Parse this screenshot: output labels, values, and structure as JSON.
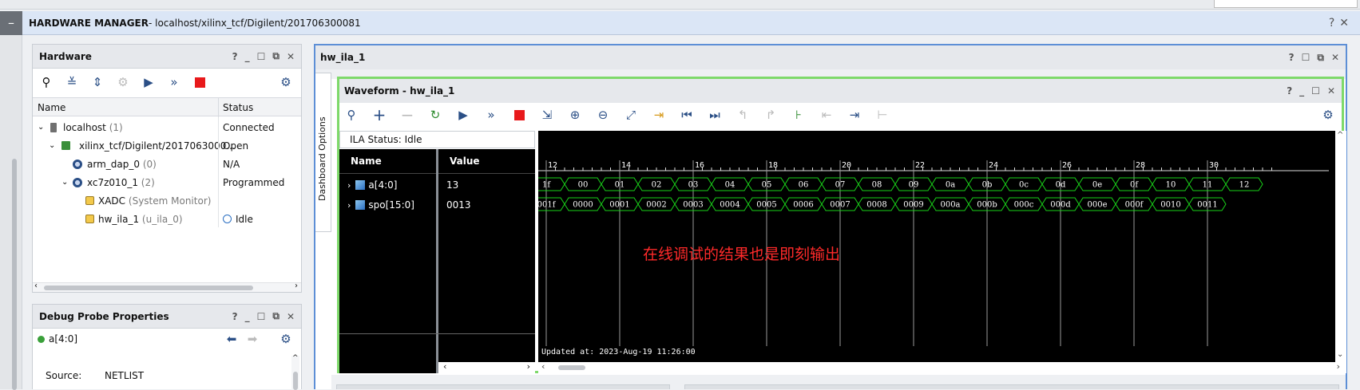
{
  "top_bar": {
    "title": "HARDWARE MANAGER",
    "subtitle": " - localhost/xilinx_tcf/Digilent/201706300081"
  },
  "hardware_panel": {
    "title": "Hardware",
    "col_name": "Name",
    "col_status": "Status",
    "rows": [
      {
        "label": "localhost",
        "extra": "(1)",
        "status": "Connected"
      },
      {
        "label": "xilinx_tcf/Digilent/2017063000...",
        "extra": "",
        "status": "Open"
      },
      {
        "label": "arm_dap_0",
        "extra": "(0)",
        "status": "N/A"
      },
      {
        "label": "xc7z010_1",
        "extra": "(2)",
        "status": "Programmed"
      },
      {
        "label": "XADC",
        "extra": "(System Monitor)",
        "status": ""
      },
      {
        "label": "hw_ila_1",
        "extra": "(u_ila_0)",
        "status": "Idle"
      }
    ]
  },
  "debug_panel": {
    "title": "Debug Probe Properties",
    "probe": "a[4:0]",
    "source_label": "Source:",
    "source_value": "NETLIST"
  },
  "ila_panel": {
    "tab": "hw_ila_1",
    "dashboard_label": "Dashboard Options",
    "waveform_title": "Waveform - hw_ila_1",
    "ila_status": "ILA Status:  Idle",
    "col_name": "Name",
    "col_value": "Value",
    "signals": [
      {
        "name": "a[4:0]",
        "value": "13"
      },
      {
        "name": "spo[15:0]",
        "value": "0013"
      }
    ],
    "timeline": [
      "12",
      "14",
      "16",
      "18",
      "20",
      "22",
      "24",
      "26",
      "28",
      "30"
    ],
    "bus_a": [
      "1f",
      "00",
      "01",
      "02",
      "03",
      "04",
      "05",
      "06",
      "07",
      "08",
      "09",
      "0a",
      "0b",
      "0c",
      "0d",
      "0e",
      "0f",
      "10",
      "11",
      "12"
    ],
    "bus_spo": [
      "001f",
      "0000",
      "0001",
      "0002",
      "0003",
      "0004",
      "0005",
      "0006",
      "0007",
      "0008",
      "0009",
      "000a",
      "000b",
      "000c",
      "000d",
      "000e",
      "000f",
      "0010",
      "0011"
    ],
    "annotation": "在线调试的结果也是即刻输出",
    "updated": "Updated at: 2023-Aug-19 11:26:00"
  },
  "colors": {
    "accent_green": "#7ed96a",
    "wave_green": "#19d219",
    "annotation_red": "#ff2a2a"
  }
}
